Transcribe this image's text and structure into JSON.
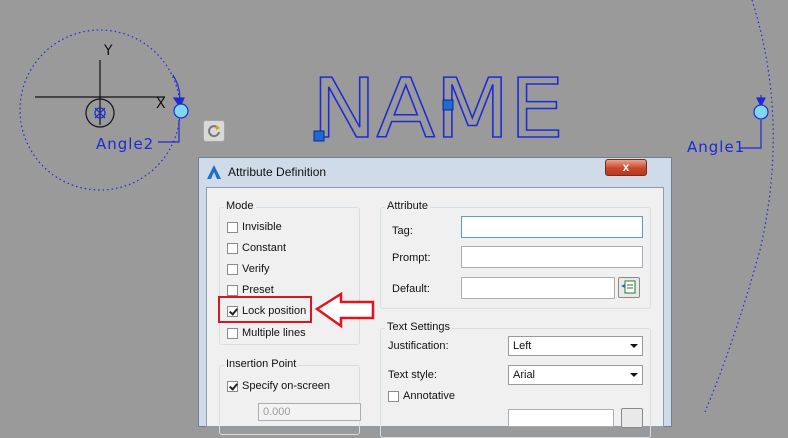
{
  "drawing": {
    "attribute_text": "NAME",
    "angle2_label": "Angle2",
    "angle1_label": "Angle1",
    "y_axis_label": "Y",
    "x_axis_label": "X"
  },
  "dialog": {
    "title": "Attribute Definition",
    "close_label": "x",
    "mode": {
      "title": "Mode",
      "options": [
        {
          "label": "Invisible",
          "checked": false
        },
        {
          "label": "Constant",
          "checked": false
        },
        {
          "label": "Verify",
          "checked": false
        },
        {
          "label": "Preset",
          "checked": false
        },
        {
          "label": "Lock position",
          "checked": true
        },
        {
          "label": "Multiple lines",
          "checked": false
        }
      ]
    },
    "insertion_point": {
      "title": "Insertion Point",
      "specify_on_screen": {
        "label": "Specify on-screen",
        "checked": true
      },
      "x_value": "0.000"
    },
    "attribute": {
      "title": "Attribute",
      "tag_label": "Tag:",
      "tag_value": "",
      "prompt_label": "Prompt:",
      "prompt_value": "",
      "default_label": "Default:",
      "default_value": ""
    },
    "text_settings": {
      "title": "Text Settings",
      "justification_label": "Justification:",
      "justification_value": "Left",
      "text_style_label": "Text style:",
      "text_style_value": "Arial",
      "annotative": {
        "label": "Annotative",
        "checked": false
      }
    }
  },
  "colors": {
    "canvas_bg": "#9a9a9a",
    "cad_blue": "#1d2bd6",
    "grip_blue": "#1e6ad6",
    "highlight_red": "#e0141e"
  }
}
